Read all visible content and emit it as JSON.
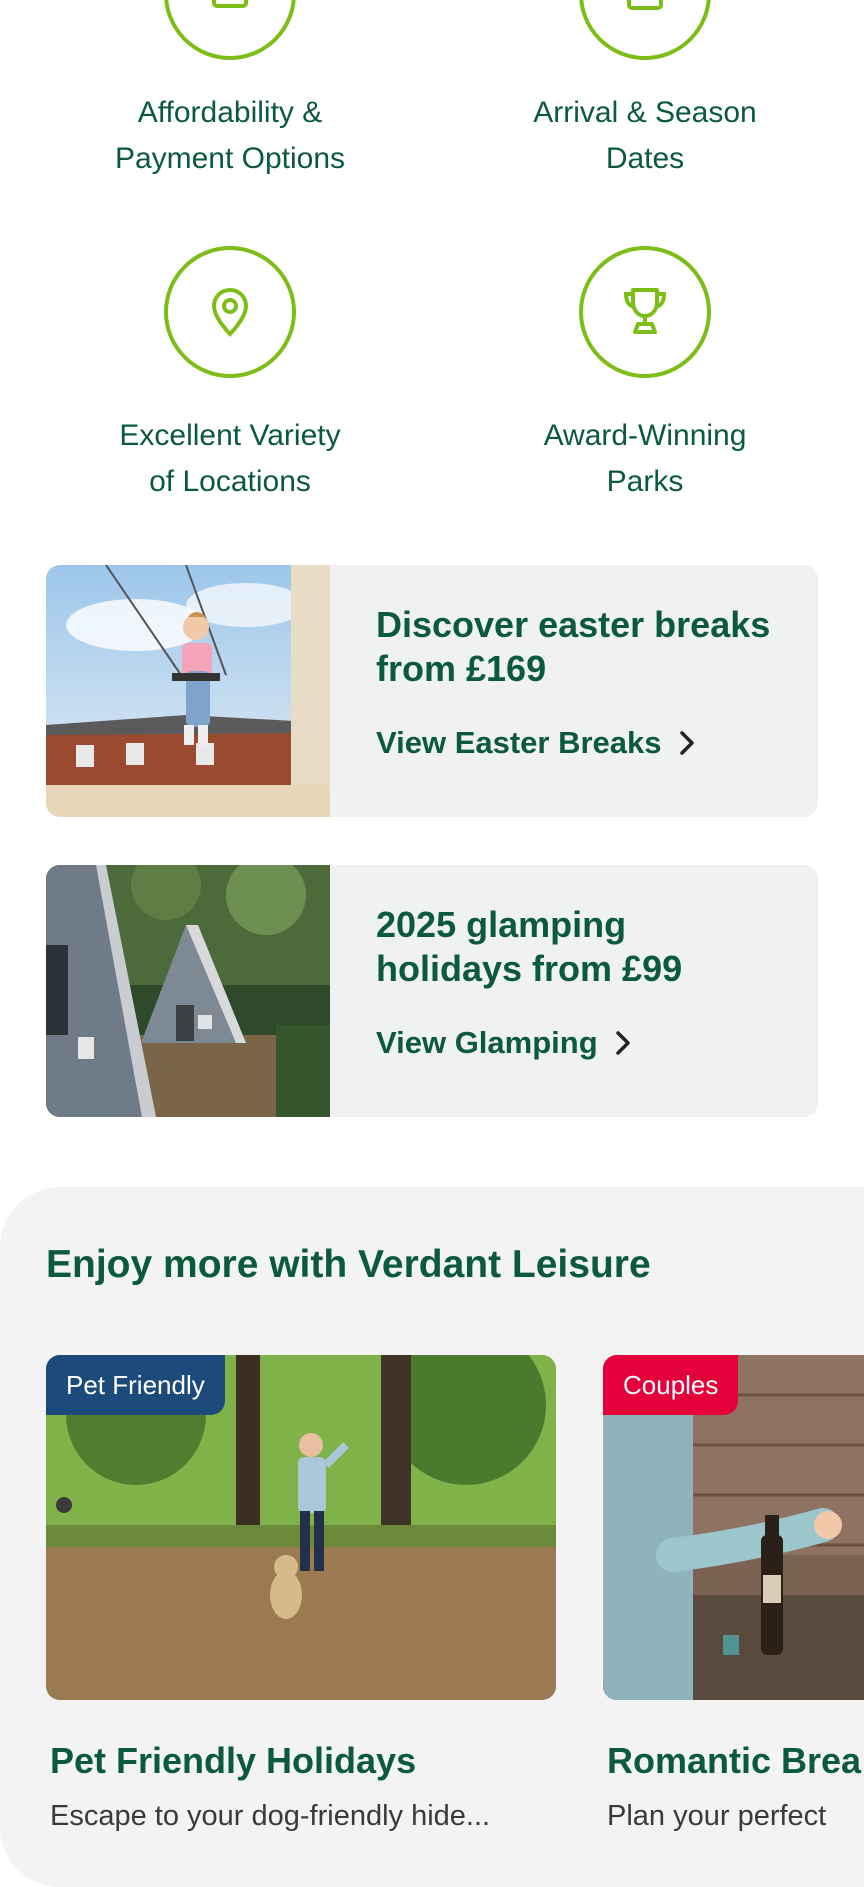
{
  "features": [
    {
      "label_line1": "Affordability &",
      "label_line2": "Payment Options",
      "icon": "payment-icon"
    },
    {
      "label_line1": "Arrival & Season",
      "label_line2": "Dates",
      "icon": "calendar-icon"
    },
    {
      "label_line1": "Excellent Variety",
      "label_line2": "of Locations",
      "icon": "location-pin-icon"
    },
    {
      "label_line1": "Award-Winning",
      "label_line2": "Parks",
      "icon": "trophy-icon"
    }
  ],
  "promos": [
    {
      "title_line1": "Discover easter breaks",
      "title_line2": "from £169",
      "link": "View Easter Breaks"
    },
    {
      "title_line1": "2025 glamping",
      "title_line2": "holidays from £99",
      "link": "View Glamping"
    }
  ],
  "more": {
    "title": "Enjoy more with Verdant Leisure",
    "cards": [
      {
        "badge": "Pet Friendly",
        "badge_color": "#1c4a7a",
        "title": "Pet Friendly Holidays",
        "desc": "Escape to your dog-friendly hide..."
      },
      {
        "badge": "Couples",
        "badge_color": "#e3003b",
        "title": "Romantic Brea",
        "desc": "Plan your perfect"
      }
    ]
  },
  "colors": {
    "brand_green": "#0b5a3c",
    "accent_green": "#7cbd18"
  }
}
